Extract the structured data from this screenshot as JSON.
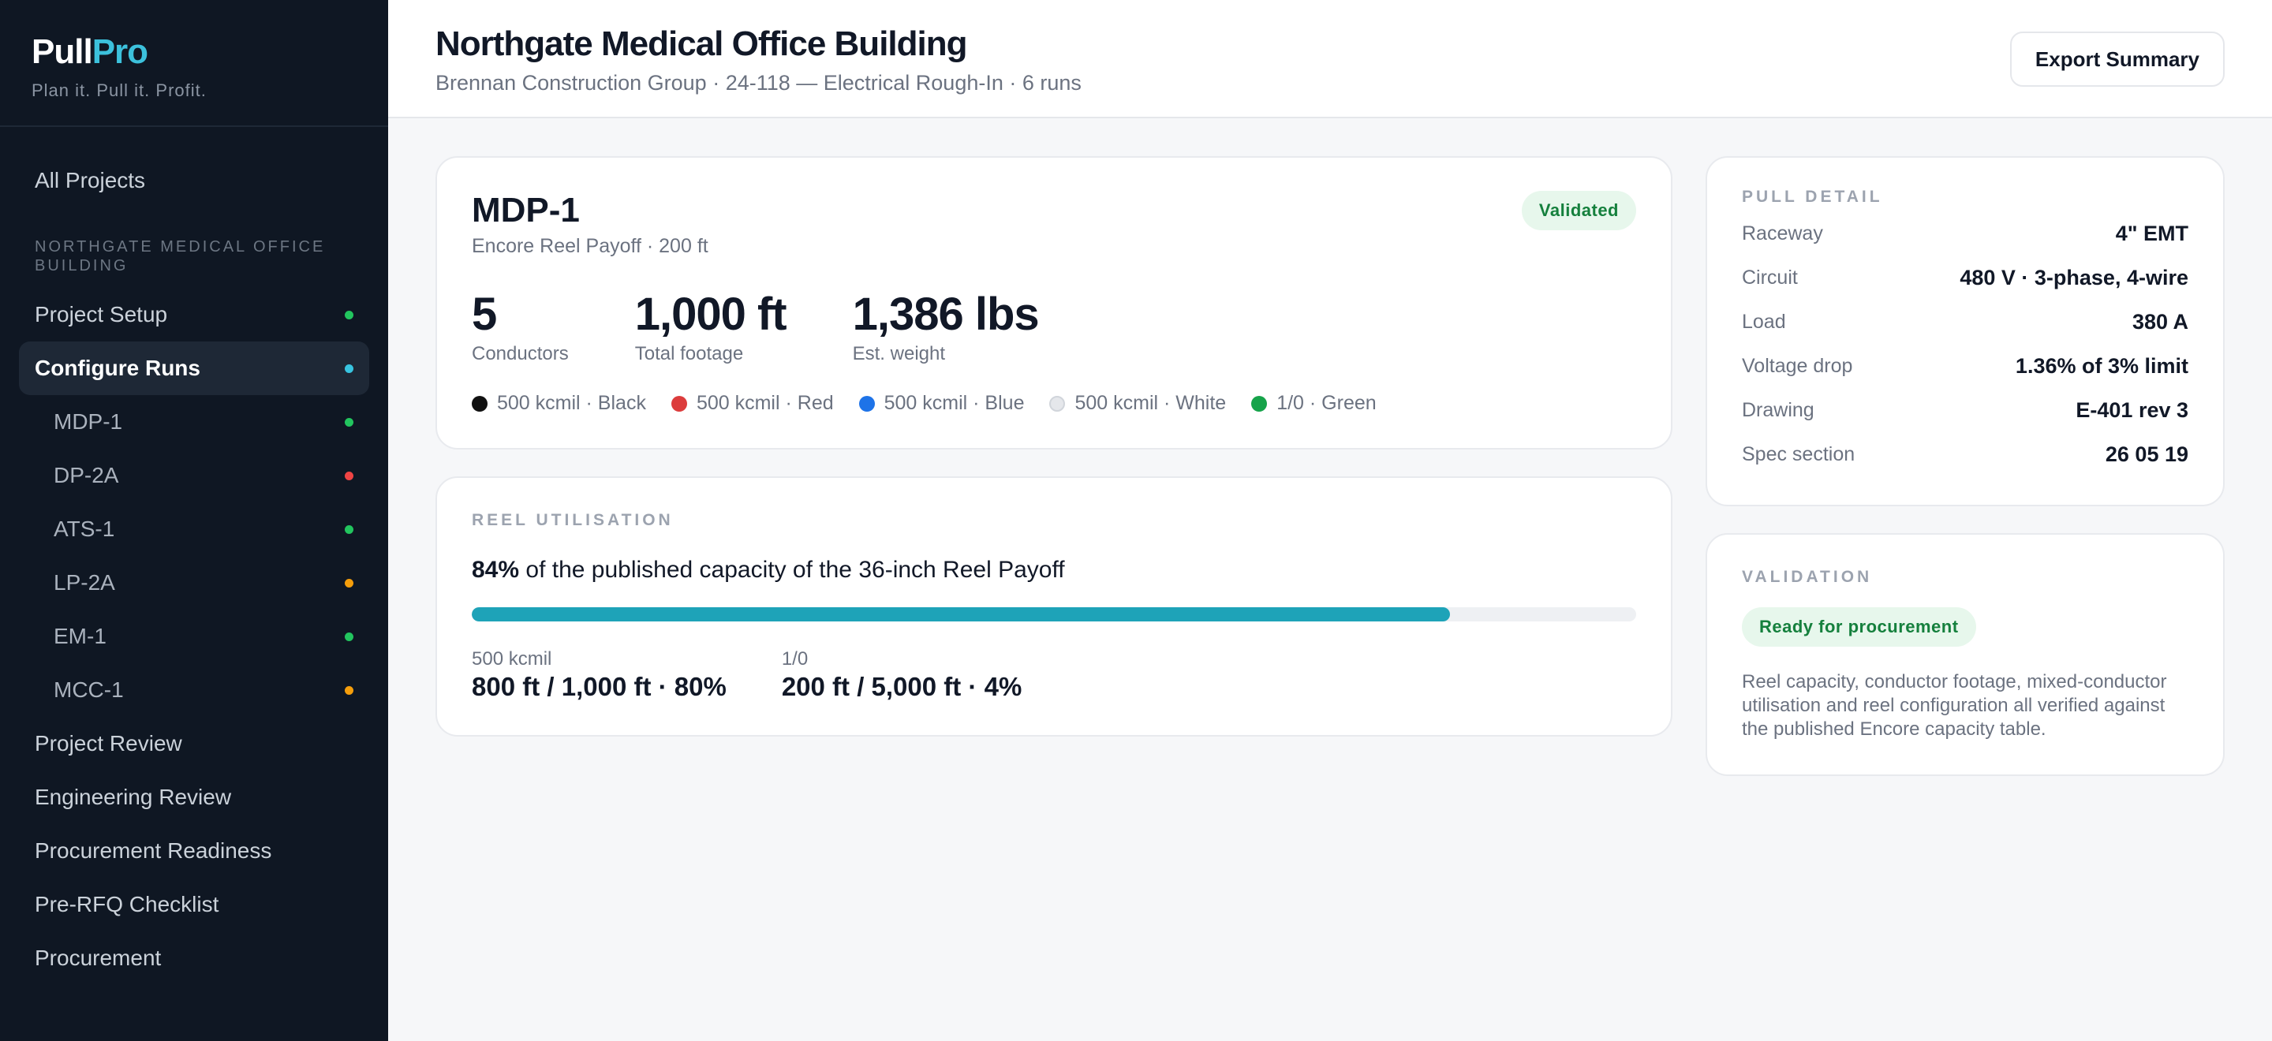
{
  "brand": {
    "name_main": "Pull",
    "name_accent": "Pro",
    "tagline": "Plan it. Pull it. Profit."
  },
  "sidebar": {
    "all_projects": "All Projects",
    "section_label": "NORTHGATE MEDICAL OFFICE BUILDING",
    "items": [
      {
        "label": "Project Setup",
        "status": "green"
      },
      {
        "label": "Configure Runs",
        "status": "cyan"
      }
    ],
    "runs": [
      {
        "label": "MDP-1",
        "status": "green"
      },
      {
        "label": "DP-2A",
        "status": "red"
      },
      {
        "label": "ATS-1",
        "status": "green"
      },
      {
        "label": "LP-2A",
        "status": "orange"
      },
      {
        "label": "EM-1",
        "status": "green"
      },
      {
        "label": "MCC-1",
        "status": "orange"
      }
    ],
    "bottom_items": [
      "Project Review",
      "Engineering Review",
      "Procurement Readiness",
      "Pre-RFQ Checklist",
      "Procurement"
    ]
  },
  "header": {
    "title": "Northgate Medical Office Building",
    "subtitle": "Brennan Construction Group · 24-118 — Electrical Rough-In · 6 runs",
    "export_label": "Export Summary"
  },
  "run": {
    "title": "MDP-1",
    "subtitle": "Encore Reel Payoff · 200 ft",
    "badge": "Validated",
    "stats": [
      {
        "value": "5",
        "label": "Conductors"
      },
      {
        "value": "1,000 ft",
        "label": "Total footage"
      },
      {
        "value": "1,386 lbs",
        "label": "Est. weight"
      }
    ],
    "conductors": [
      {
        "label": "500 kcmil · Black",
        "color": "#111111"
      },
      {
        "label": "500 kcmil · Red",
        "color": "#dc3c3c"
      },
      {
        "label": "500 kcmil · Blue",
        "color": "#1e73e8"
      },
      {
        "label": "500 kcmil · White",
        "color": "#e5e7eb"
      },
      {
        "label": "1/0 · Green",
        "color": "#16a34a"
      }
    ]
  },
  "reel": {
    "label": "REEL UTILISATION",
    "percent_text": "84%",
    "rest_text": " of the published capacity of the 36-inch Reel Payoff",
    "fill_percent": 84,
    "rows": [
      {
        "name": "500 kcmil",
        "value": "800 ft / 1,000 ft · 80%"
      },
      {
        "name": "1/0",
        "value": "200 ft / 5,000 ft · 4%"
      }
    ]
  },
  "pull_detail": {
    "label": "PULL DETAIL",
    "rows": [
      {
        "key": "Raceway",
        "value": "4\" EMT"
      },
      {
        "key": "Circuit",
        "value": "480 V · 3-phase, 4-wire"
      },
      {
        "key": "Load",
        "value": "380 A"
      },
      {
        "key": "Voltage drop",
        "value": "1.36% of 3% limit"
      },
      {
        "key": "Drawing",
        "value": "E-401 rev 3"
      },
      {
        "key": "Spec section",
        "value": "26 05 19"
      }
    ]
  },
  "validation": {
    "label": "VALIDATION",
    "badge": "Ready for procurement",
    "text": "Reel capacity, conductor footage, mixed-conductor utilisation and reel configuration all verified against the published Encore capacity table."
  }
}
